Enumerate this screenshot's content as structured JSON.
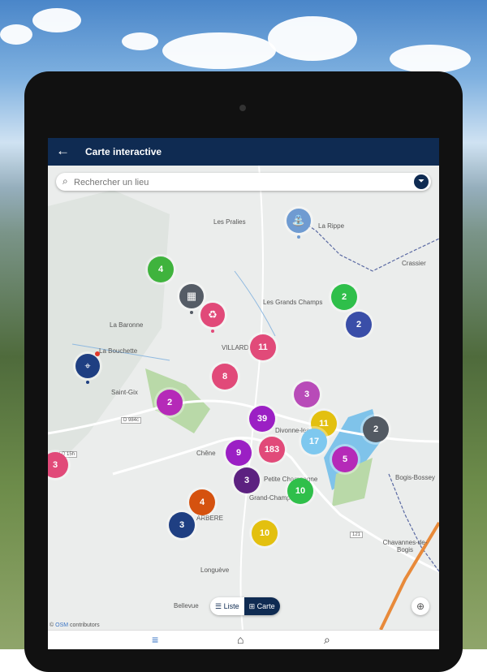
{
  "app": {
    "title": "Carte interactive",
    "back_icon": "←"
  },
  "search": {
    "placeholder": "Rechercher un lieu",
    "icon": "⌕"
  },
  "filter": {
    "icon": "⏷"
  },
  "places": [
    "Les Pralies",
    "La Rippe",
    "Crassier",
    "Les Grands Champs",
    "La Baronne",
    "La Bouchette",
    "VILLARD",
    "Saint-Gix",
    "Grand-Champ",
    "Petite Champagne",
    "Divonne-les-Bains",
    "ARBERE",
    "Chavannes-de-Bogis",
    "Bogis-Bossey",
    "Longuève",
    "Bellevue",
    "Chêne"
  ],
  "roads": [
    "D 984c",
    "D 15h",
    "121"
  ],
  "clusters": [
    {
      "value": "4",
      "color": "#3fb33d"
    },
    {
      "value": "2",
      "color": "#2fbf4a"
    },
    {
      "value": "2",
      "color": "#3a4ea8"
    },
    {
      "value": "11",
      "color": "#e14a79"
    },
    {
      "value": "8",
      "color": "#e14a79"
    },
    {
      "value": "2",
      "color": "#b52ab8"
    },
    {
      "value": "3",
      "color": "#b84bb8"
    },
    {
      "value": "39",
      "color": "#9b1fc4"
    },
    {
      "value": "11",
      "color": "#e3c00f"
    },
    {
      "value": "2",
      "color": "#535a63"
    },
    {
      "value": "17",
      "color": "#7ec8ef"
    },
    {
      "value": "9",
      "color": "#9b1fc4"
    },
    {
      "value": "183",
      "color": "#e14a79"
    },
    {
      "value": "5",
      "color": "#b52ab8"
    },
    {
      "value": "3",
      "color": "#5c2180"
    },
    {
      "value": "10",
      "color": "#2fbf4a"
    },
    {
      "value": "4",
      "color": "#d5520f"
    },
    {
      "value": "3",
      "color": "#1f3f82"
    },
    {
      "value": "10",
      "color": "#e3c00f"
    },
    {
      "value": "3",
      "color": "#e14a79"
    }
  ],
  "pois": [
    {
      "icon": "faucet-icon",
      "glyph": "⛲",
      "color": "#6f9bd1"
    },
    {
      "icon": "building-icon",
      "glyph": "▦",
      "color": "#555c66"
    },
    {
      "icon": "bin-icon",
      "glyph": "♻",
      "color": "#e14a79"
    },
    {
      "icon": "location-pin-icon",
      "glyph": "⌖",
      "color": "#1f3f82"
    }
  ],
  "view_toggle": {
    "list_label": "Liste",
    "map_label": "Carte",
    "list_icon": "☰",
    "map_icon": "⊞"
  },
  "locate_icon": "⊕",
  "attribution": {
    "prefix": "©",
    "link": "OSM",
    "suffix": "contributors"
  },
  "bottom_nav": {
    "menu": "≡",
    "home": "⌂",
    "search": "⌕"
  }
}
